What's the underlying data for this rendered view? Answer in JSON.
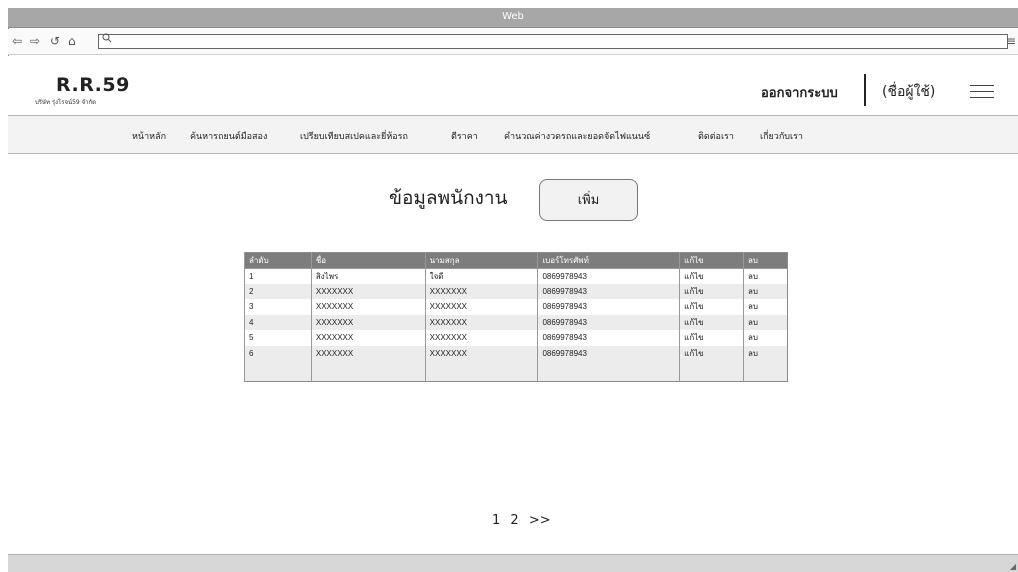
{
  "window": {
    "title": "Web"
  },
  "browser": {
    "back_icon": "⇦",
    "forward_icon": "⇨",
    "reload_icon": "↺",
    "home_icon": "⌂",
    "url_value": "",
    "search_icon": "search-icon"
  },
  "header": {
    "logo": "R.R.59",
    "company": "บริษัท รุ่งโรจน์59 จำกัด",
    "logout_label": "ออกจากระบบ",
    "username_label": "(ชื่อผู้ใช้)"
  },
  "menu": {
    "items": [
      "หน้าหลัก",
      "ค้นหารถยนต์มือสอง",
      "เปรียบเทียบสเปคและยี่ห้อรถ",
      "ตีราคา",
      "คำนวณค่างวดรถและยอดจัดไฟแนนซ์",
      "ติดต่อเรา",
      "เกี่ยวกับเรา"
    ]
  },
  "main": {
    "title": "ข้อมูลพนักงาน",
    "add_label": "เพิ่ม"
  },
  "table": {
    "headers": [
      "ลำดับ",
      "ชื่อ",
      "นามสกุล",
      "เบอร์โทรศัพท์",
      "แก้ไข",
      "ลบ"
    ],
    "rows": [
      [
        "1",
        "สิงไพร",
        "ใจดี",
        "0869978943",
        "แก้ไข",
        "ลบ"
      ],
      [
        "2",
        "XXXXXXX",
        "XXXXXXX",
        "0869978943",
        "แก้ไข",
        "ลบ"
      ],
      [
        "3",
        "XXXXXXX",
        "XXXXXXX",
        "0869978943",
        "แก้ไข",
        "ลบ"
      ],
      [
        "4",
        "XXXXXXX",
        "XXXXXXX",
        "0869978943",
        "แก้ไข",
        "ลบ"
      ],
      [
        "5",
        "XXXXXXX",
        "XXXXXXX",
        "0869978943",
        "แก้ไข",
        "ลบ"
      ],
      [
        "6",
        "XXXXXXX",
        "XXXXXXX",
        "0869978943",
        "แก้ไข",
        "ลบ"
      ],
      [
        "",
        "",
        "",
        "",
        "",
        ""
      ]
    ]
  },
  "pagination": {
    "pages": [
      "1",
      "2"
    ],
    "next": ">>"
  }
}
